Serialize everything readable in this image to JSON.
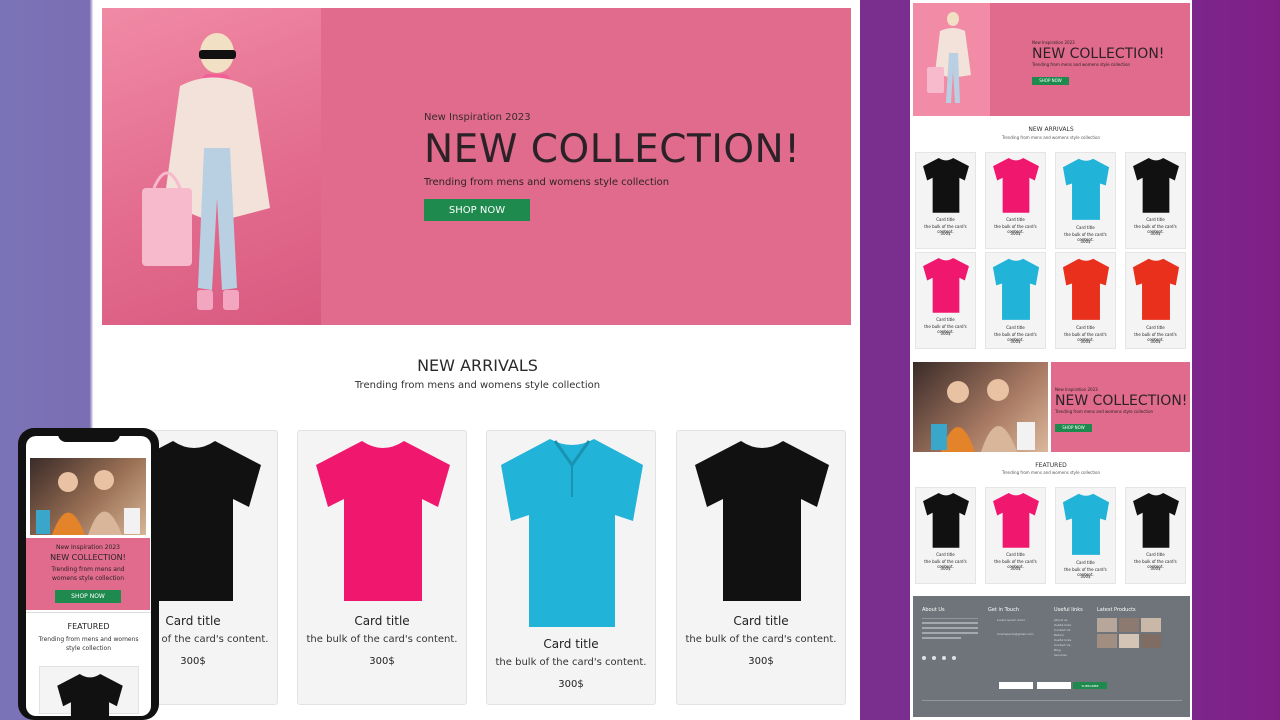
{
  "desktop": {
    "hero": {
      "kicker": "New Inspiration 2023",
      "title": "NEW COLLECTION!",
      "subtitle": "Trending from mens and womens style collection",
      "button": "SHOP NOW"
    },
    "section": {
      "title": "NEW ARRIVALS",
      "subtitle": "Trending from mens and womens style collection"
    },
    "cards": [
      {
        "title": "Card title",
        "text": "the bulk of the card's content.",
        "price": "300$",
        "color": "#111111"
      },
      {
        "title": "Card title",
        "text": "the bulk of the card's content.",
        "price": "300$",
        "color": "#f0186e"
      },
      {
        "title": "Card title",
        "text": "the bulk of the card's content.",
        "price": "300$",
        "color": "#22b3d8"
      },
      {
        "title": "Card title",
        "text": "the bulk of the card's content.",
        "price": "300$",
        "color": "#111111"
      }
    ]
  },
  "tablet": {
    "hero": {
      "kicker": "New Inspiration 2023",
      "title": "NEW COLLECTION!",
      "subtitle": "Trending from mens and womens style collection",
      "button": "SHOP NOW"
    },
    "arrivals": {
      "title": "NEW ARRIVALS",
      "subtitle": "Trending from mens and womens style collection"
    },
    "card_title": "Card title",
    "card_text": "the bulk of the card's content.",
    "card_price": "300$",
    "banner": {
      "kicker": "New Inspiration 2023",
      "title": "NEW COLLECTION!",
      "subtitle": "Trending from mens and womens style collection",
      "button": "SHOP NOW"
    },
    "featured": {
      "title": "FEATURED",
      "subtitle": "Trending from mens and womens style collection"
    },
    "footer": {
      "about": "About Us",
      "contact": "Get in Touch",
      "links": "Useful links",
      "products": "Latest Products",
      "address": "Lorem ipsum dolor",
      "email": "loremipsum@gmail.com",
      "link_items": [
        "About us",
        "Useful links",
        "Contact Us",
        "Return",
        "Useful links",
        "Contact Us",
        "Blog",
        "Services"
      ],
      "subscribe": "SUBSCRIBE"
    }
  },
  "mobile": {
    "kicker": "New Inspiration 2023",
    "title": "NEW COLLECTION!",
    "subtitle": "Trending from mens and womens style collection",
    "button": "SHOP NOW",
    "featured_title": "FEATURED",
    "featured_subtitle": "Trending from mens and womens style collection"
  }
}
